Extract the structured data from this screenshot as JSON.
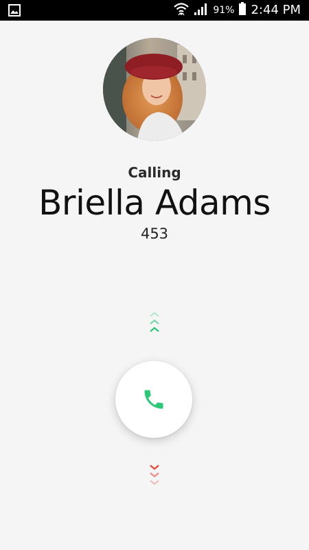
{
  "status_bar": {
    "battery_percent": "91%",
    "time": "2:44 PM",
    "notification_icon": "image-icon",
    "wifi_icon": "wifi-icon",
    "signal_icon": "cell-signal-icon",
    "battery_icon": "battery-icon"
  },
  "call": {
    "status": "Calling",
    "contact_name": "Briella Adams",
    "number": "453"
  },
  "controls": {
    "swipe_up_icon": "chevron-up-icon",
    "answer_icon": "phone-icon",
    "swipe_down_icon": "chevron-down-icon"
  },
  "colors": {
    "accent_green": "#2dc878",
    "decline_red": "#e84a3a",
    "background": "#f5f5f5"
  }
}
